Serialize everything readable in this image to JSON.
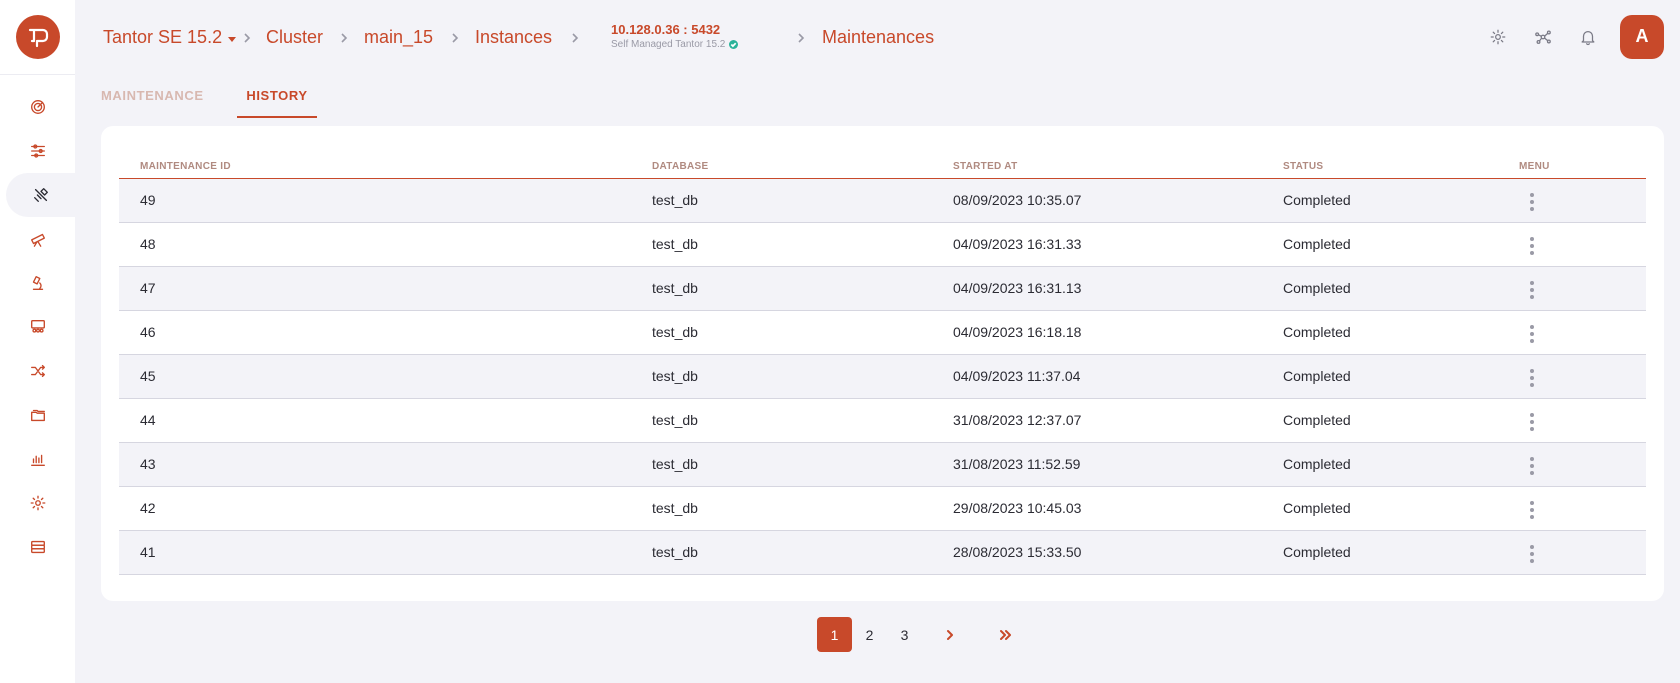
{
  "breadcrumb": {
    "product": "Tantor SE 15.2",
    "cluster": "Cluster",
    "db": "main_15",
    "instances": "Instances",
    "instance_address": "10.128.0.36 : 5432",
    "instance_subtitle": "Self Managed Tantor 15.2",
    "current": "Maintenances"
  },
  "user": {
    "initial": "A"
  },
  "tabs": {
    "maintenance": "MAINTENANCE",
    "history": "HISTORY"
  },
  "table": {
    "headers": [
      "MAINTENANCE ID",
      "DATABASE",
      "STARTED AT",
      "STATUS",
      "MENU"
    ],
    "rows": [
      [
        "49",
        "test_db",
        "08/09/2023 10:35.07",
        "Completed"
      ],
      [
        "48",
        "test_db",
        "04/09/2023 16:31.33",
        "Completed"
      ],
      [
        "47",
        "test_db",
        "04/09/2023 16:31.13",
        "Completed"
      ],
      [
        "46",
        "test_db",
        "04/09/2023 16:18.18",
        "Completed"
      ],
      [
        "45",
        "test_db",
        "04/09/2023 11:37.04",
        "Completed"
      ],
      [
        "44",
        "test_db",
        "31/08/2023 12:37.07",
        "Completed"
      ],
      [
        "43",
        "test_db",
        "31/08/2023 11:52.59",
        "Completed"
      ],
      [
        "42",
        "test_db",
        "29/08/2023 10:45.03",
        "Completed"
      ],
      [
        "41",
        "test_db",
        "28/08/2023 15:33.50",
        "Completed"
      ]
    ]
  },
  "pagination": {
    "pages": [
      "1",
      "2",
      "3"
    ],
    "current": "1"
  },
  "sidebar_icons": [
    "dashboard-icon",
    "sliders-icon",
    "tools-icon",
    "telescope-icon",
    "microscope-icon",
    "team-icon",
    "shuffle-icon",
    "folders-icon",
    "bar-chart-icon",
    "settings-icon",
    "storage-icon"
  ],
  "colors": {
    "accent": "#c8492a",
    "background": "#f3f3f8",
    "success": "#2bb39a"
  }
}
